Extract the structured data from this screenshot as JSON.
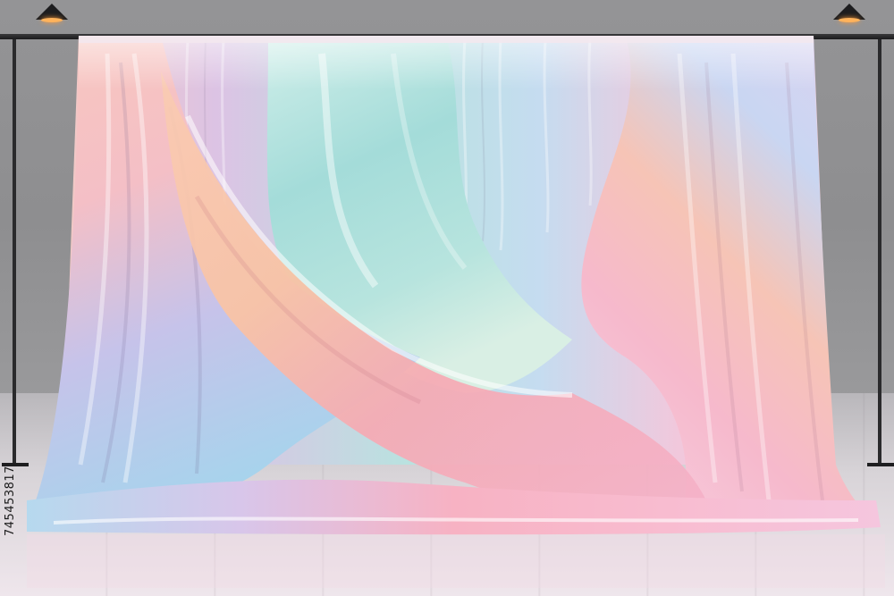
{
  "image": {
    "stock_id": "745453817"
  },
  "scene": {
    "subject": "iridescent-pastel-fabric-backdrop",
    "colors": {
      "wall": "#909092",
      "floor": "#e6dfe4",
      "pink": "#f7b8c8",
      "peach": "#fbc9a8",
      "aqua": "#a9e2de",
      "lavender": "#cdbde8",
      "sky": "#b8d6f0"
    }
  }
}
